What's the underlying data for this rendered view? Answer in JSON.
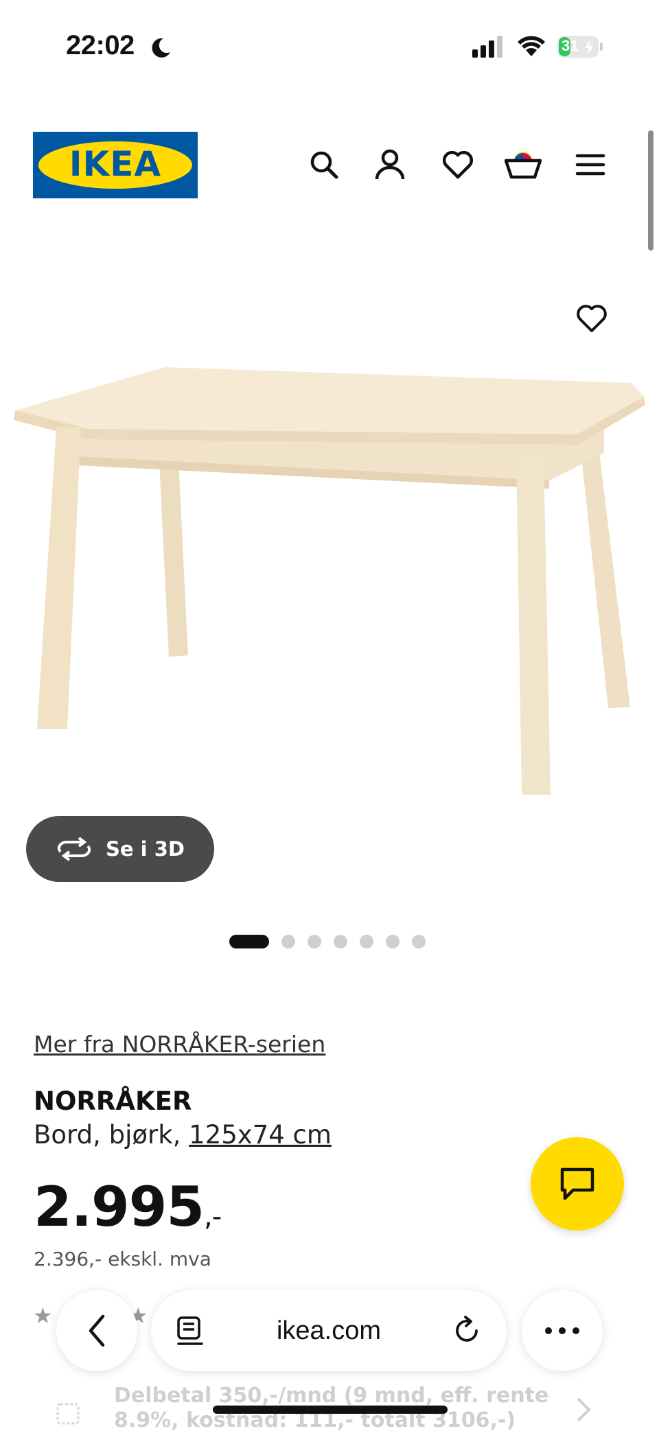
{
  "status_bar": {
    "time": "22:02",
    "battery": "31",
    "battery_level": 0.31
  },
  "header": {
    "logo_text": "IKEA",
    "icons": [
      "search-icon",
      "user-icon",
      "heart-icon",
      "basket-icon",
      "menu-icon"
    ]
  },
  "product": {
    "see_3d_label": "Se i 3D",
    "carousel": {
      "total": 7,
      "active_index": 0
    },
    "series_link": "Mer fra NORRÅKER-serien",
    "name": "NORRÅKER",
    "description": "Bord, bjørk,",
    "dimension_link": "125x74 cm",
    "price": "2.995",
    "price_suffix": ",-",
    "price_ex_vat": "2.396,- ekskl. mva",
    "installment": "Delbetal 350,-/mnd (9 mnd, eff. rente 8.9%, kostnad: 111,- totalt 3106,-)"
  },
  "browser": {
    "url": "ikea.com"
  },
  "colors": {
    "ikea_blue": "#0058a3",
    "ikea_yellow": "#ffdb00",
    "battery_green": "#34c759",
    "button_dark": "#4a4a4a"
  }
}
